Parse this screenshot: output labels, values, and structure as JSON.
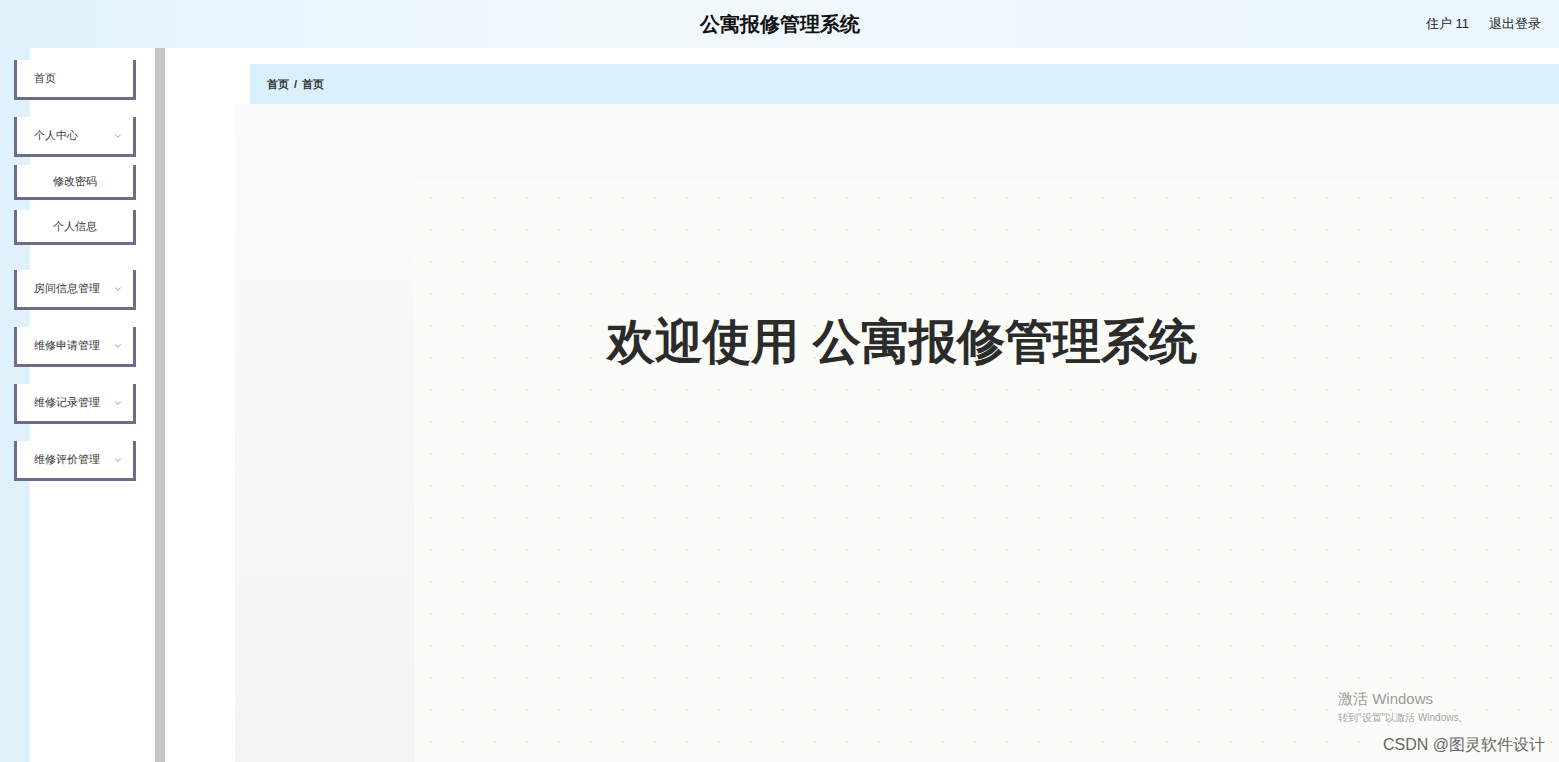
{
  "window": {
    "title": "公寓报修管理系统"
  },
  "header": {
    "user": "住户 11",
    "logout": "退出登录"
  },
  "sidebar": {
    "items": [
      {
        "label": "首页",
        "kind": "link",
        "expanded": false,
        "children": []
      },
      {
        "label": "个人中心",
        "kind": "group",
        "expanded": true,
        "children": [
          {
            "label": "修改密码"
          },
          {
            "label": "个人信息"
          }
        ]
      },
      {
        "label": "房间信息管理",
        "kind": "group",
        "expanded": false,
        "children": []
      },
      {
        "label": "维修申请管理",
        "kind": "group",
        "expanded": false,
        "children": []
      },
      {
        "label": "维修记录管理",
        "kind": "group",
        "expanded": false,
        "children": []
      },
      {
        "label": "维修评价管理",
        "kind": "group",
        "expanded": false,
        "children": []
      }
    ]
  },
  "breadcrumb": {
    "items": [
      "首页",
      "首页"
    ],
    "separator": "/"
  },
  "banner": {
    "title": "欢迎使用 公寓报修管理系统"
  },
  "watermarks": {
    "activation_title": "激活 Windows",
    "activation_hint": "转到\"设置\"以激活 Windows。",
    "credit": "CSDN @图灵软件设计"
  }
}
